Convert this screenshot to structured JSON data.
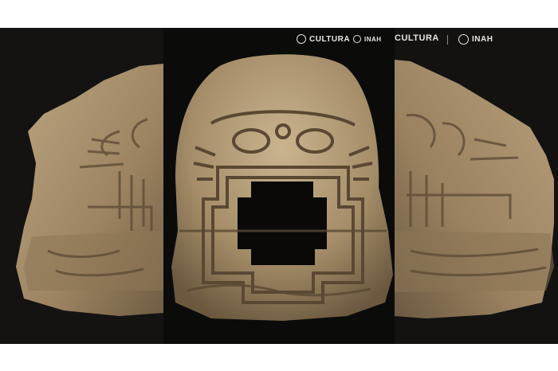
{
  "logos": {
    "cultura_label": "CULTURA",
    "inah_label": "INAH",
    "cultura_partial_label": "CULTURA"
  },
  "colors": {
    "background": "#0e0d0c",
    "stone": "#a8906c",
    "stone_dark": "#6f5c42",
    "stone_light": "#c9b48f"
  }
}
